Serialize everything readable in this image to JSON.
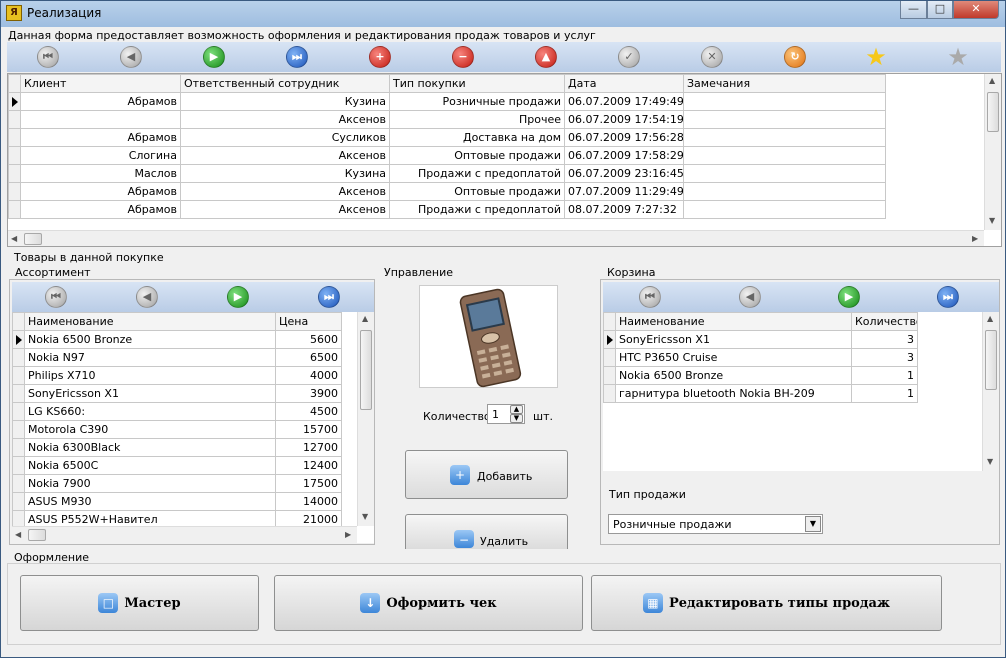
{
  "window": {
    "title": "Реализация",
    "min": "—",
    "max": "□",
    "close": "✕"
  },
  "caption": "Данная форма предоставляет возможность оформления и редактирования продаж товаров и услуг",
  "sales": {
    "columns": [
      "Клиент",
      "Ответственный  сотрудник",
      "Тип покупки",
      "Дата",
      "Замечания"
    ],
    "rows": [
      [
        "Абрамов",
        "Кузина",
        "Розничные продажи",
        "06.07.2009 17:49:49",
        ""
      ],
      [
        "",
        "Аксенов",
        "Прочее",
        "06.07.2009 17:54:19",
        ""
      ],
      [
        "Абрамов",
        "Сусликов",
        "Доставка на дом",
        "06.07.2009 17:56:28",
        ""
      ],
      [
        "Слогина",
        "Аксенов",
        "Оптовые продажи",
        "06.07.2009 17:58:29",
        ""
      ],
      [
        "Маслов",
        "Кузина",
        "Продажи с предоплатой",
        "06.07.2009 23:16:45",
        ""
      ],
      [
        "Абрамов",
        "Аксенов",
        "Оптовые продажи",
        "07.07.2009 11:29:49",
        ""
      ],
      [
        "Абрамов",
        "Аксенов",
        "Продажи с предоплатой",
        "08.07.2009 7:27:32",
        ""
      ]
    ]
  },
  "goods_label": "Товары в данной покупке",
  "assortment": {
    "label": "Ассортимент",
    "columns": [
      "Наименование",
      "Цена"
    ],
    "rows": [
      [
        "Nokia 6500 Bronze",
        "5600"
      ],
      [
        "Nokia N97",
        "6500"
      ],
      [
        "Philips X710",
        "4000"
      ],
      [
        "SonyEricsson X1",
        "3900"
      ],
      [
        "LG KS660:",
        "4500"
      ],
      [
        "Motorola C390",
        "15700"
      ],
      [
        "Nokia 6300Black",
        "12700"
      ],
      [
        "Nokia 6500C",
        "12400"
      ],
      [
        "Nokia 7900",
        "17500"
      ],
      [
        "ASUS M930",
        "14000"
      ],
      [
        "ASUS P552W+Навител",
        "21000"
      ]
    ]
  },
  "control": {
    "label": "Управление",
    "qty_label": "Количество",
    "qty_value": "1",
    "unit": "шт.",
    "add": "Добавить",
    "remove": "Удалить"
  },
  "cart": {
    "label": "Корзина",
    "columns": [
      "Наименование",
      "Количество"
    ],
    "rows": [
      [
        "SonyEricsson X1",
        "3"
      ],
      [
        "HTC P3650 Cruise",
        "3"
      ],
      [
        "Nokia 6500 Bronze",
        "1"
      ],
      [
        "гарнитура bluetooth Nokia BH-209",
        "1"
      ]
    ],
    "sale_type_label": "Тип продажи",
    "sale_type_value": "Розничные продажи"
  },
  "footer": {
    "label": "Оформление",
    "master": "Мастер",
    "check": "Оформить чек",
    "edit_types": "Редактировать типы продаж"
  }
}
